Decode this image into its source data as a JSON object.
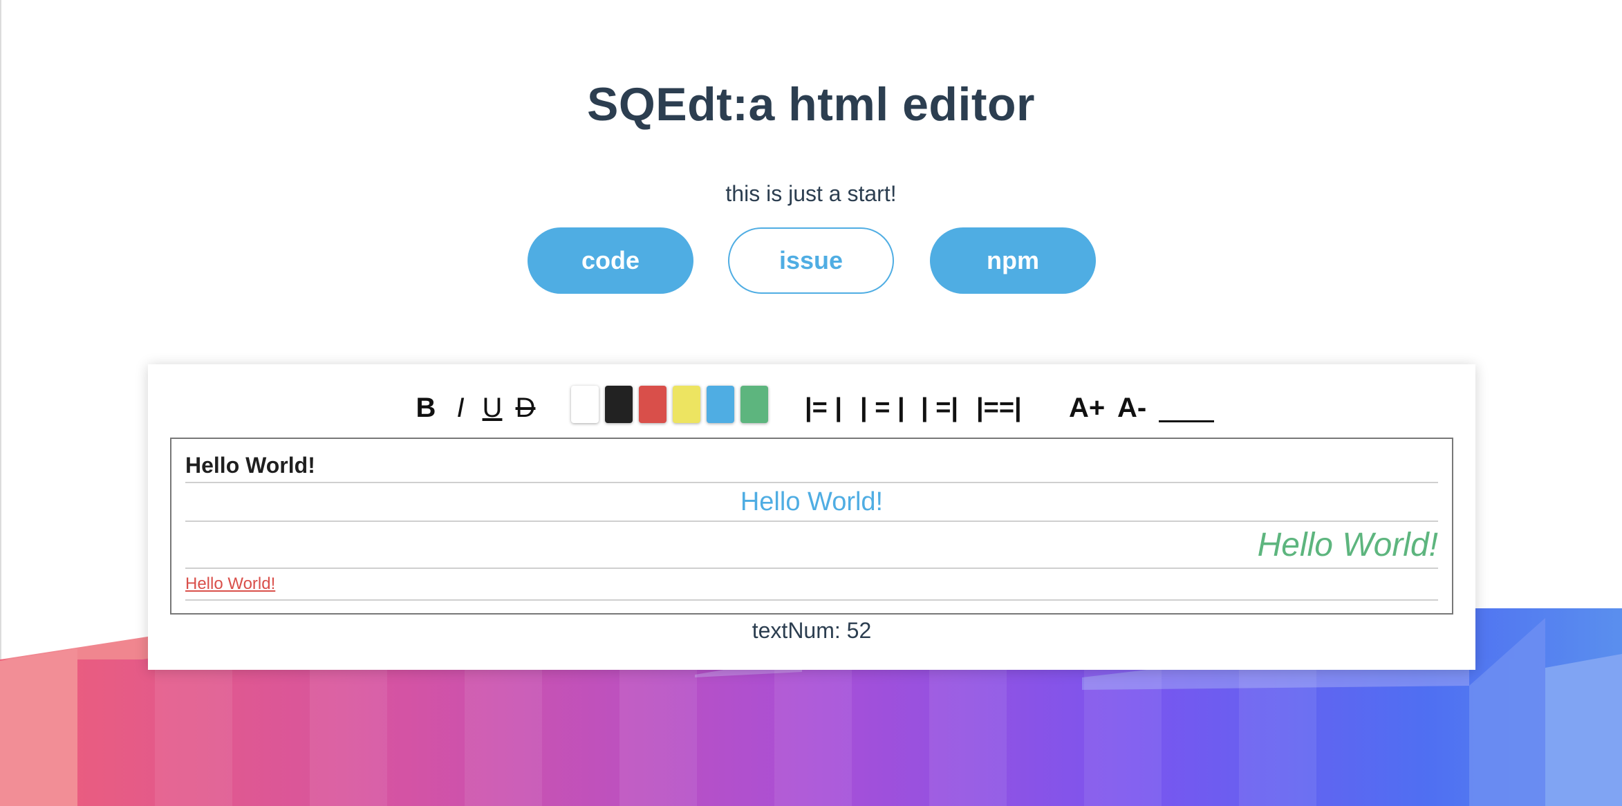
{
  "header": {
    "title": "SQEdt:a html editor",
    "subtitle": "this is just a start!"
  },
  "links": [
    {
      "label": "code",
      "style": "filled"
    },
    {
      "label": "issue",
      "style": "outline"
    },
    {
      "label": "npm",
      "style": "filled"
    }
  ],
  "toolbar": {
    "bold": "B",
    "italic": "I",
    "underline": "U",
    "strike": "D",
    "colors": [
      "#ffffff",
      "#222222",
      "#d94f4a",
      "#ede461",
      "#4fade3",
      "#5db57e"
    ],
    "align_left": "|= |",
    "align_center": "| = |",
    "align_right": "| =|",
    "align_justify": "|==|",
    "size_up": "A+",
    "size_down": "A-",
    "rule_icon": "horizontal-rule-icon"
  },
  "editor": {
    "lines": [
      {
        "text": "Hello World!",
        "style": "bold",
        "align": "left",
        "color": "#1f1f1f"
      },
      {
        "text": "Hello World!",
        "style": "normal",
        "align": "center",
        "color": "#4fade3"
      },
      {
        "text": "Hello World!",
        "style": "italic",
        "align": "right",
        "color": "#5db57e"
      },
      {
        "text": "Hello World!",
        "style": "underline",
        "align": "left",
        "color": "#d94f4a"
      }
    ]
  },
  "status": {
    "text_num": "textNum: 52"
  },
  "theme": {
    "accent": "#4fade3",
    "text": "#2c3e50"
  }
}
